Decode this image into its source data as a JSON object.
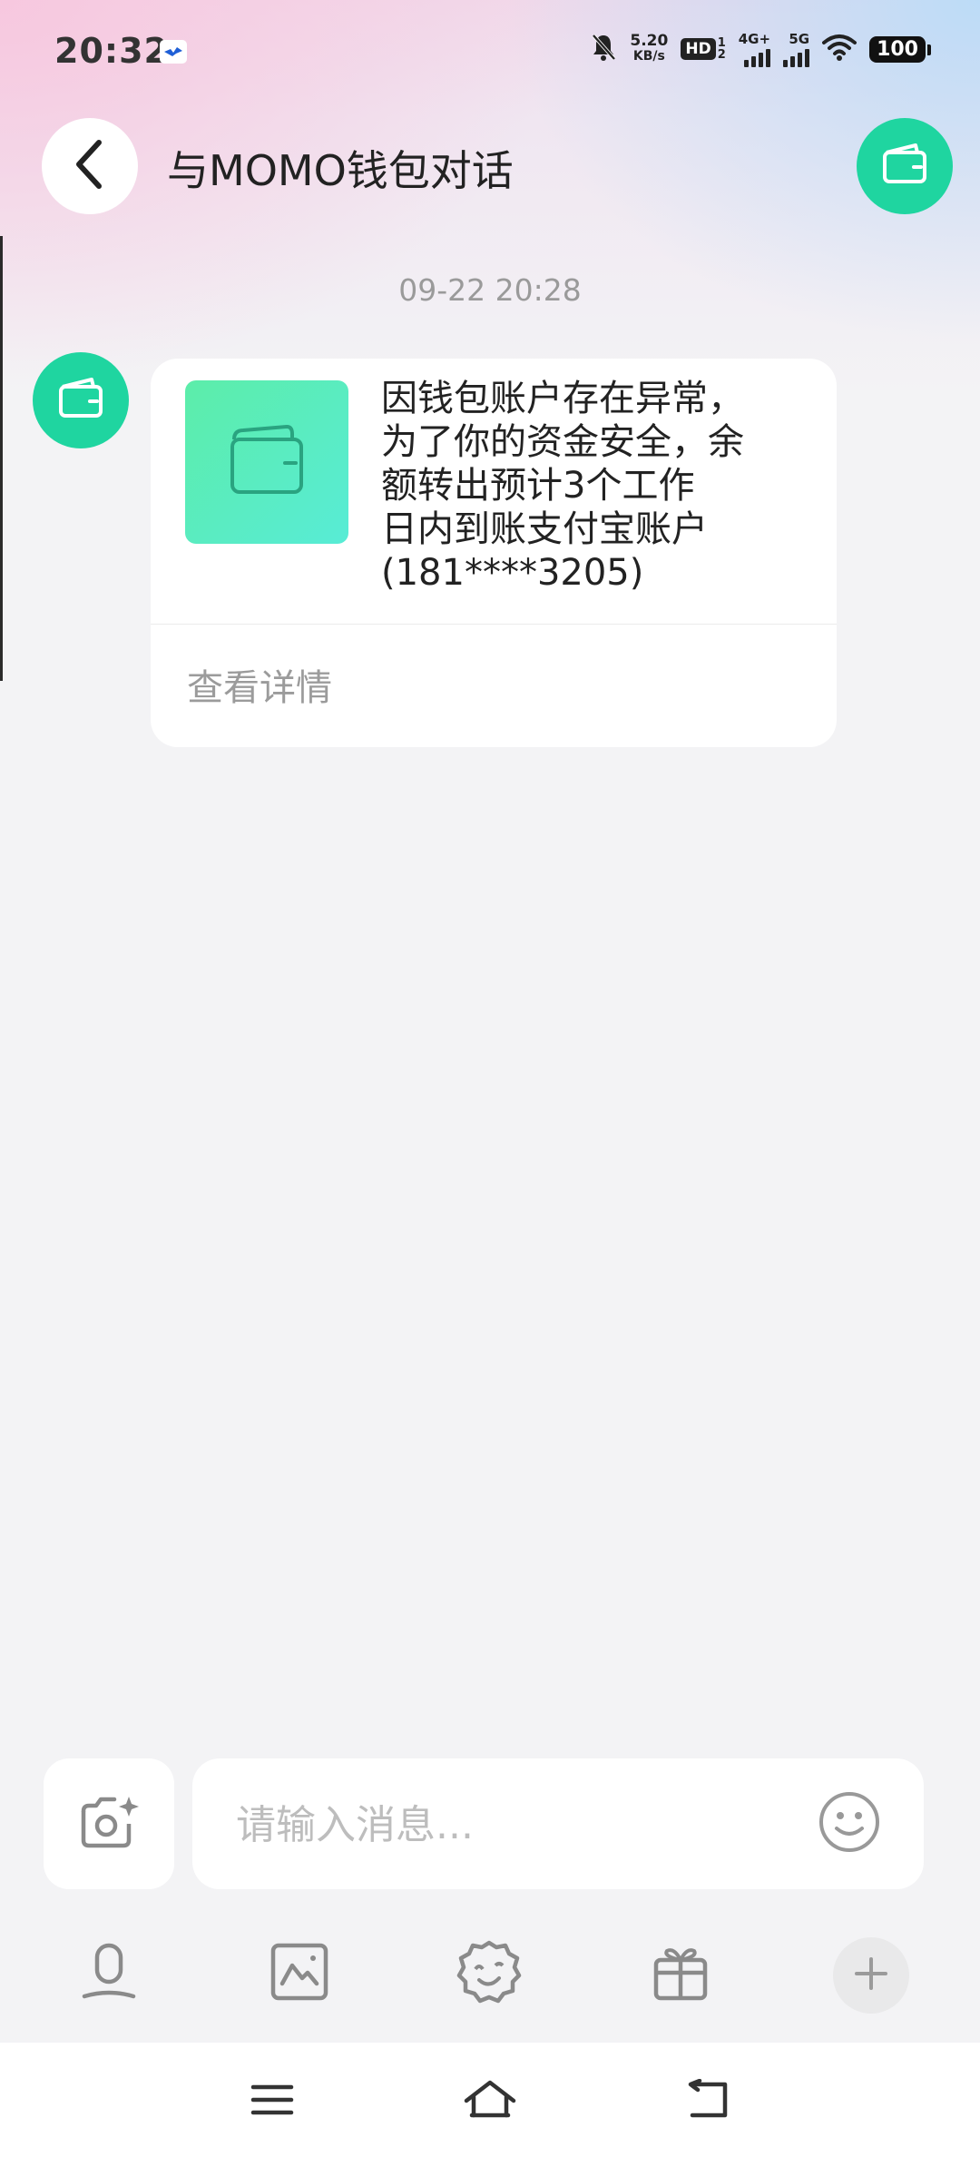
{
  "status_bar": {
    "time": "20:32",
    "net_speed_value": "5.20",
    "net_speed_unit": "KB/s",
    "hd_label": "HD",
    "hd_sim_top": "1",
    "hd_sim_bottom": "2",
    "network_1": "4G+",
    "network_2": "5G",
    "battery": "100",
    "icons": [
      "notification-muted-icon",
      "wifi-icon",
      "signal-icon"
    ]
  },
  "header": {
    "back_icon": "chevron-left-icon",
    "title": "与MOMO钱包对话",
    "avatar_icon": "wallet-icon"
  },
  "chat": {
    "timestamp": "09-22 20:28",
    "messages": [
      {
        "sender_icon": "wallet-icon",
        "text": "因钱包账户存在异常，\n为了你的资金安全，余\n额转出预计3个工作\n日内到账支付宝账户\n(181****3205)",
        "link_label": "查看详情"
      }
    ]
  },
  "composer": {
    "placeholder": "请输入消息...",
    "value": "",
    "camera_icon": "camera-icon",
    "emoji_icon": "emoji-smile-icon"
  },
  "toolbar": {
    "items": [
      "voice-icon",
      "image-icon",
      "sticker-icon",
      "gift-icon",
      "plus-icon"
    ]
  },
  "system_nav": {
    "items": [
      "menu-icon",
      "home-icon",
      "back-icon"
    ]
  },
  "colors": {
    "accent": "#1fd5a0",
    "thumb_gradient_start": "#5ceda9",
    "thumb_gradient_end": "#58ecd6",
    "background": "#f3f3f5"
  }
}
